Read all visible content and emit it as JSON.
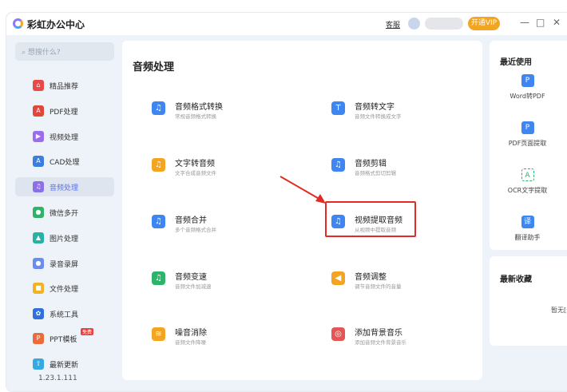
{
  "app": {
    "title": "彩虹办公中心",
    "kefu": "客服",
    "vip": "开通VIP",
    "minimize": "—",
    "maximize": "□",
    "close": "✕"
  },
  "sidebar": {
    "search_placeholder": "想搜什么?",
    "items": [
      {
        "label": "精品推荐",
        "icon": "⌂",
        "color": "#e84a4a"
      },
      {
        "label": "PDF处理",
        "icon": "A",
        "color": "#e0463c"
      },
      {
        "label": "视频处理",
        "icon": "▶",
        "color": "#9b6cf0"
      },
      {
        "label": "CAD处理",
        "icon": "A",
        "color": "#3b7de0"
      },
      {
        "label": "音频处理",
        "icon": "♫",
        "color": "#8b6fe8"
      },
      {
        "label": "微信多开",
        "icon": "●",
        "color": "#2fb36a"
      },
      {
        "label": "图片处理",
        "icon": "▲",
        "color": "#26b3a6"
      },
      {
        "label": "录音录屏",
        "icon": "●",
        "color": "#6a8ef0"
      },
      {
        "label": "文件处理",
        "icon": "■",
        "color": "#f3b21f"
      },
      {
        "label": "系统工具",
        "icon": "✿",
        "color": "#2f6fe0"
      },
      {
        "label": "PPT模板",
        "icon": "P",
        "color": "#ec6b3d",
        "badge": "免费"
      },
      {
        "label": "最新更新",
        "icon": "⇧",
        "color": "#38a9e0"
      }
    ],
    "version": "1.23.1.111"
  },
  "main": {
    "title": "音频处理",
    "tools": [
      {
        "title": "音频格式转换",
        "sub": "常规音频格式转换",
        "icon": "♫",
        "color": "#3f86f0"
      },
      {
        "title": "音频转文字",
        "sub": "音频文件转换成文字",
        "icon": "T",
        "color": "#3f86f0"
      },
      {
        "title": "文字转音频",
        "sub": "文字合成音频文件",
        "icon": "♫",
        "color": "#f3a521"
      },
      {
        "title": "音频剪辑",
        "sub": "音频格式剪切剪辑",
        "icon": "♫",
        "color": "#3f86f0"
      },
      {
        "title": "音频合并",
        "sub": "多个音频格式合并",
        "icon": "♫",
        "color": "#3f86f0"
      },
      {
        "title": "视频提取音频",
        "sub": "从视频中提取音频",
        "icon": "♫",
        "color": "#3f86f0"
      },
      {
        "title": "音频变速",
        "sub": "音频文件加减速",
        "icon": "♫",
        "color": "#2fb36a"
      },
      {
        "title": "音频调整",
        "sub": "调节音频文件的音量",
        "icon": "◀",
        "color": "#f3a521"
      },
      {
        "title": "噪音消除",
        "sub": "音频文件降噪",
        "icon": "≋",
        "color": "#f3a521"
      },
      {
        "title": "添加背景音乐",
        "sub": "添加音频文件背景音乐",
        "icon": "◎",
        "color": "#e45656"
      }
    ]
  },
  "recent": {
    "title": "最近使用",
    "items": [
      {
        "label": "Word转PDF",
        "icon": "P"
      },
      {
        "label": "PDF页面提取",
        "icon": "P"
      },
      {
        "label": "OCR文字提取",
        "icon": "A"
      },
      {
        "label": "翻译助手",
        "icon": "译"
      }
    ]
  },
  "favorites": {
    "title": "最新收藏",
    "empty": "暂无[最"
  }
}
